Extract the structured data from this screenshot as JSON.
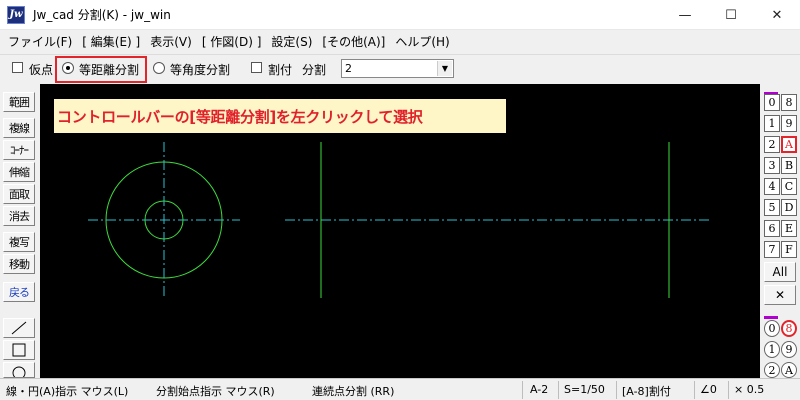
{
  "window": {
    "icon_text": "Jw",
    "title": "Jw_cad 分割(K) - jw_win",
    "minimize": "—",
    "maximize": "☐",
    "close": "✕"
  },
  "menu": [
    "ファイル(F)",
    "[ 編集(E) ]",
    "表示(V)",
    "[ 作図(D) ]",
    "設定(S)",
    "[その他(A)]",
    "ヘルプ(H)"
  ],
  "controlbar": {
    "kariten_label": "仮点",
    "equal_division_label": "等距離分割",
    "equal_angle_label": "等角度分割",
    "waritsuke_label": "割付",
    "bunkatsu_label": "分割",
    "division_count": "2",
    "kariten_checked": false,
    "equal_division_selected": true,
    "waritsuke_checked": false
  },
  "left_tools": [
    "範囲",
    "複線",
    "ｺｰﾅｰ",
    "伸縮",
    "面取",
    "消去",
    "複写",
    "移動",
    "戻る"
  ],
  "left_draw_tools": [
    "line-icon",
    "rectangle-icon",
    "circle-icon"
  ],
  "instruction_banner": "コントロールバーの[等距離分割]を左クリックして選択",
  "right_layers": {
    "left_col": [
      "0",
      "1",
      "2",
      "3",
      "4",
      "5",
      "6",
      "7"
    ],
    "right_col": [
      "8",
      "9",
      "A",
      "B",
      "C",
      "D",
      "E",
      "F"
    ],
    "active": "A",
    "all_label": "All",
    "cross_label": "✕",
    "group_left": [
      "0",
      "1",
      "2"
    ],
    "group_right": [
      "8",
      "9",
      "A"
    ],
    "active_group": "8"
  },
  "status": {
    "left": "線・円(A)指示 マウス(L)",
    "middle": "分割始点指示 マウス(R)",
    "right": "連続点分割 (RR)",
    "paper": "A-2",
    "scale": "S=1/50",
    "layer": "[A-8]割付",
    "angle": "∠0",
    "zoom": "× 0.5"
  },
  "colors": {
    "canvas_bg": "#000000",
    "drawing_line": "#3ddc3d",
    "center_line": "#2fbfd0",
    "highlight": "#e3242b",
    "banner_bg": "#fff6c8",
    "banner_text": "#e0202a"
  }
}
